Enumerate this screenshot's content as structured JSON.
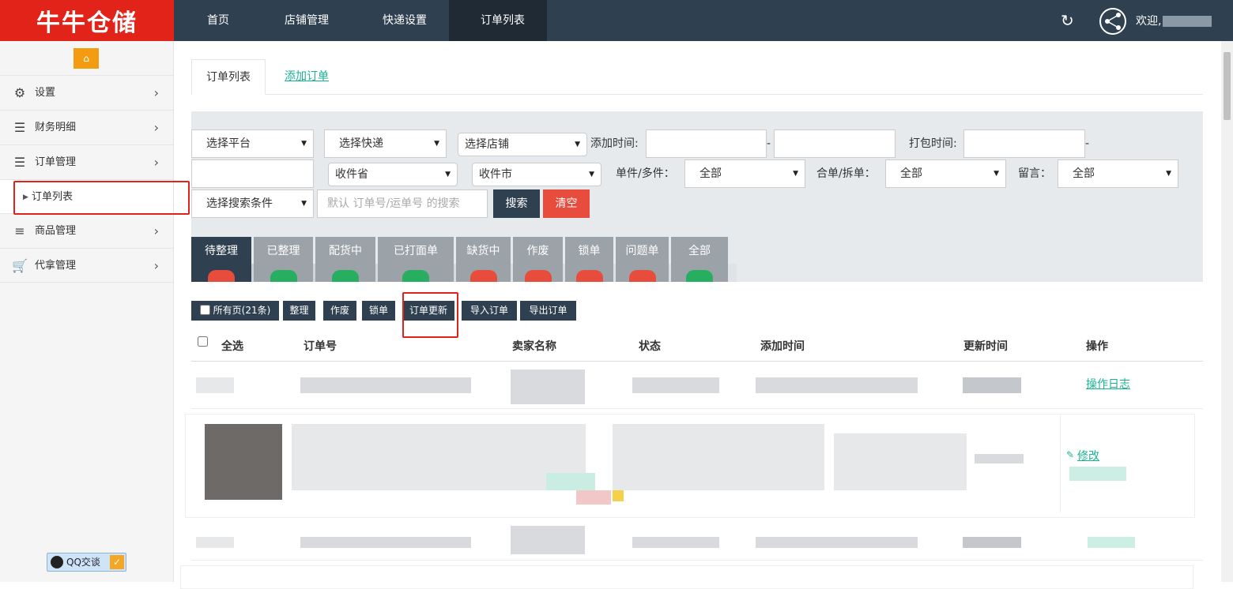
{
  "app": {
    "logo_text": "牛牛仓储"
  },
  "nav": {
    "items": [
      "首页",
      "店铺管理",
      "快递设置",
      "订单列表"
    ],
    "active_index": 3,
    "welcome": "欢迎,"
  },
  "sidebar": {
    "home_icon": "home-icon",
    "items": [
      {
        "label": "设置",
        "icon": "gear-icon"
      },
      {
        "label": "财务明细",
        "icon": "menu-icon"
      },
      {
        "label": "订单管理",
        "icon": "menu-icon"
      },
      {
        "label": "订单列表",
        "icon": "caret-right-icon",
        "sub": true
      },
      {
        "label": "商品管理",
        "icon": "list-icon"
      },
      {
        "label": "代拿管理",
        "icon": "cart-icon"
      }
    ],
    "qq_label": "QQ交谈"
  },
  "tabs": {
    "list": "订单列表",
    "add": "添加订单"
  },
  "filter": {
    "platform": "选择平台",
    "express": "选择快递",
    "shop": "选择店铺",
    "add_time_label": "添加时间:",
    "dash": "-",
    "pack_time_label": "打包时间:",
    "province": "收件省",
    "city": "收件市",
    "single_multi_label": "单件/多件：",
    "single_multi_value": "全部",
    "merge_split_label": "合单/拆单：",
    "merge_split_value": "全部",
    "message_label": "留言：",
    "message_value": "全部",
    "search_condition": "选择搜索条件",
    "search_placeholder": "默认 订单号/运单号 的搜索",
    "search_btn": "搜索",
    "clear_btn": "清空"
  },
  "status_tabs": [
    {
      "label": "待整理",
      "color": "#e74c3c"
    },
    {
      "label": "已整理",
      "color": "#27ae60"
    },
    {
      "label": "配货中",
      "color": "#27ae60"
    },
    {
      "label": "已打面单",
      "color": "#27ae60"
    },
    {
      "label": "缺货中",
      "color": "#e74c3c"
    },
    {
      "label": "作废",
      "color": "#e74c3c"
    },
    {
      "label": "锁单",
      "color": "#e74c3c"
    },
    {
      "label": "问题单",
      "color": "#e74c3c"
    },
    {
      "label": "全部",
      "color": "#27ae60"
    }
  ],
  "toolbar": {
    "all_pages": "所有页(21条)",
    "organize": "整理",
    "void": "作废",
    "lock": "锁单",
    "update": "订单更新",
    "import": "导入订单",
    "export": "导出订单"
  },
  "table": {
    "headers": [
      "全选",
      "订单号",
      "卖家名称",
      "状态",
      "添加时间",
      "更新时间",
      "操作"
    ],
    "row1_action": "操作日志",
    "row2_action": "修改"
  }
}
